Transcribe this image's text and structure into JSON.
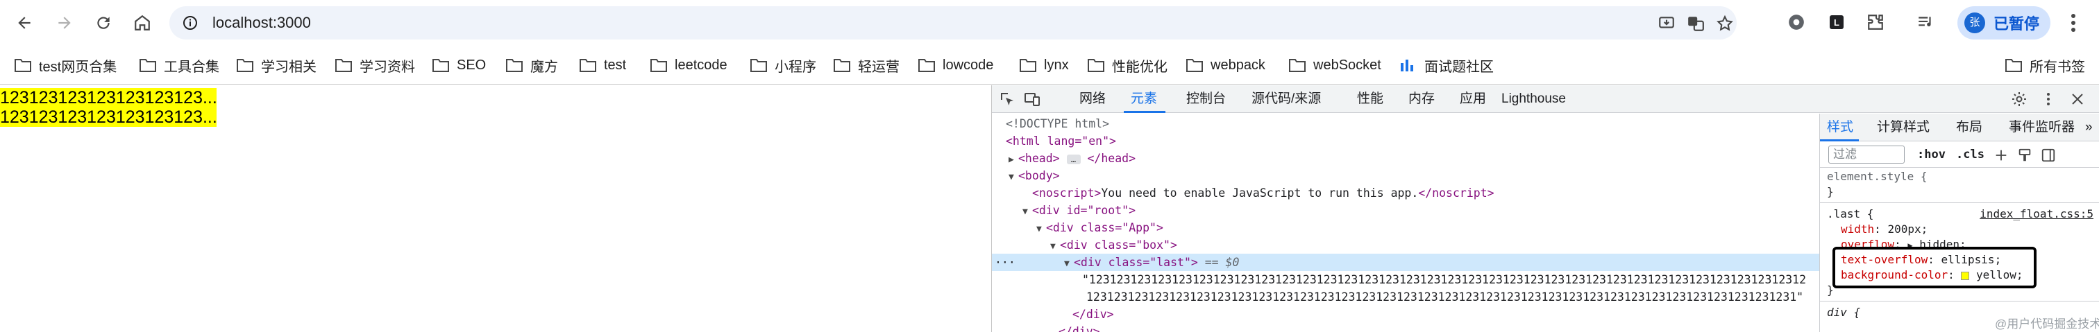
{
  "browser": {
    "url": "localhost:3000",
    "profile_label": "已暂停",
    "profile_initial": "张"
  },
  "bookmarks": [
    {
      "label": "test网页合集"
    },
    {
      "label": "工具合集"
    },
    {
      "label": "学习相关"
    },
    {
      "label": "学习资料"
    },
    {
      "label": "SEO"
    },
    {
      "label": "魔方"
    },
    {
      "label": "test"
    },
    {
      "label": "leetcode"
    },
    {
      "label": "小程序"
    },
    {
      "label": "轻运营"
    },
    {
      "label": "lowcode"
    },
    {
      "label": "lynx"
    },
    {
      "label": "性能优化"
    },
    {
      "label": "webpack"
    },
    {
      "label": "webSocket"
    },
    {
      "label": "面试题社区"
    }
  ],
  "bookmarks_all": "所有书签",
  "page": {
    "line1": "123123123123123123123...",
    "line2": "123123123123123123123..."
  },
  "devtools": {
    "tabs": [
      "网络",
      "元素",
      "控制台",
      "源代码/来源",
      "性能",
      "内存",
      "应用",
      "Lighthouse"
    ],
    "active_tab": "元素",
    "dom": {
      "doctype": "<!DOCTYPE html>",
      "html_open": "<html lang=\"en\">",
      "head": "<head>",
      "head_close": "</head>",
      "body_open": "<body>",
      "noscript_open": "<noscript>",
      "noscript_text": "You need to enable JavaScript to run this app.",
      "noscript_close": "</noscript>",
      "root_open": "<div id=\"root\">",
      "app_open": "<div class=\"App\">",
      "box_open": "<div class=\"box\">",
      "last_open": "<div class=\"last\">",
      "last_marker": "== $0",
      "text_line1": "\"12312312312312312312312312312312312312312312312312312312312312312312312312312312312312312312312312312312",
      "text_line2": "1231231231231231231231231231231231231231231231231231231231231231231231231231231231231231231231231231231\"",
      "div_close": "</div>",
      "div_close2": "</div>"
    },
    "styles": {
      "tabs": [
        "样式",
        "计算样式",
        "布局",
        "事件监听器"
      ],
      "active_tab": "样式",
      "filter_placeholder": "过滤",
      "hov": ":hov",
      "cls": ".cls",
      "element_style": "element.style {",
      "close_brace": "}",
      "rule_selector": ".last {",
      "rule_source": "index_float.css:5",
      "props": [
        {
          "name": "width",
          "value": "200px;"
        },
        {
          "name": "overflow",
          "value": "hidden;"
        },
        {
          "name": "text-overflow",
          "value": "ellipsis;"
        },
        {
          "name": "background-color",
          "value": "yellow;"
        }
      ],
      "next_selector": "div {"
    }
  },
  "watermark": "@用户代码掘金技术社区",
  "colors": {
    "highlight": "#ffff00",
    "accent": "#1a73e8"
  }
}
